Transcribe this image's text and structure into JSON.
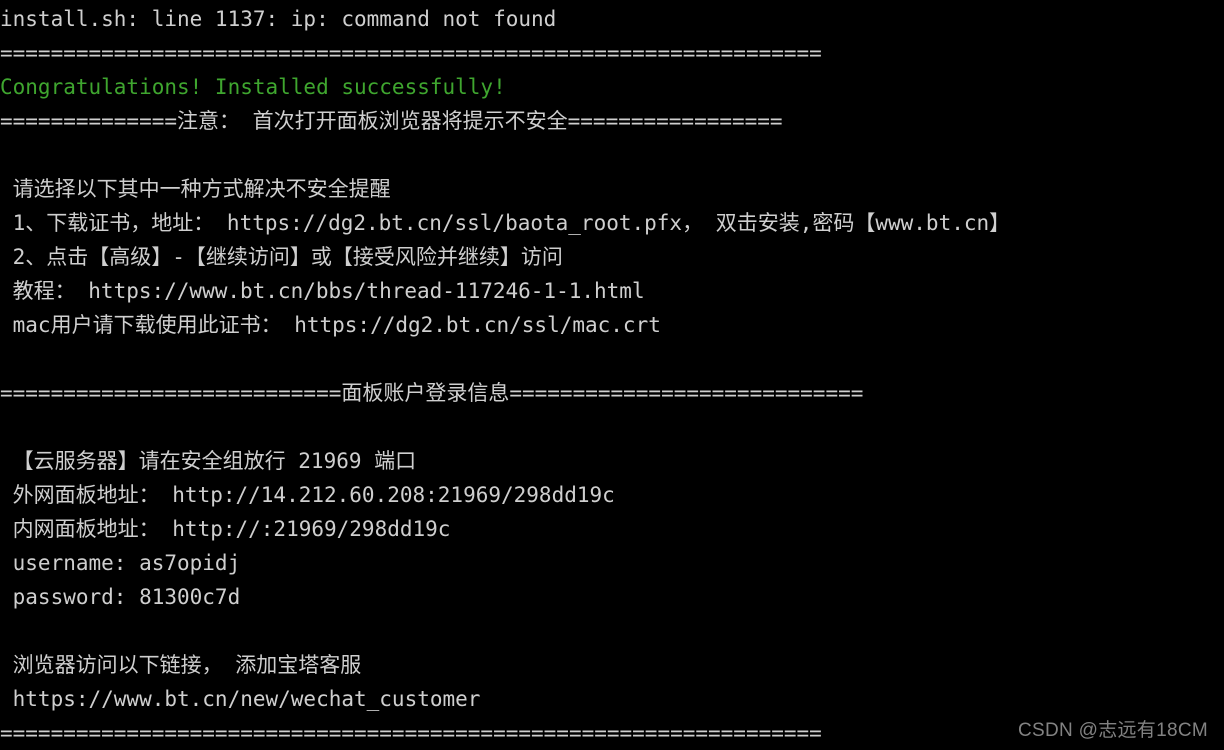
{
  "terminal": {
    "background_color": "#000000",
    "foreground_color": "#cfcfcf",
    "success_color": "#3fa62f",
    "lines": [
      {
        "id": "l01",
        "text": "install.sh: line 1137: ip: command not found",
        "style": "normal"
      },
      {
        "id": "l02",
        "text": "=================================================================",
        "style": "sep"
      },
      {
        "id": "l03",
        "text": "Congratulations! Installed successfully!",
        "style": "green"
      },
      {
        "id": "l04",
        "text": "==============注意： 首次打开面板浏览器将提示不安全=================",
        "style": "normal"
      },
      {
        "id": "l05",
        "text": "",
        "style": "blank"
      },
      {
        "id": "l06",
        "text": " 请选择以下其中一种方式解决不安全提醒",
        "style": "normal"
      },
      {
        "id": "l07",
        "text": " 1、下载证书，地址： https://dg2.bt.cn/ssl/baota_root.pfx， 双击安装,密码【www.bt.cn】",
        "style": "normal"
      },
      {
        "id": "l08",
        "text": " 2、点击【高级】-【继续访问】或【接受风险并继续】访问",
        "style": "normal"
      },
      {
        "id": "l09",
        "text": " 教程： https://www.bt.cn/bbs/thread-117246-1-1.html",
        "style": "normal"
      },
      {
        "id": "l10",
        "text": " mac用户请下载使用此证书： https://dg2.bt.cn/ssl/mac.crt",
        "style": "normal"
      },
      {
        "id": "l11",
        "text": "",
        "style": "blank"
      },
      {
        "id": "l12",
        "text": "===========================面板账户登录信息============================",
        "style": "normal"
      },
      {
        "id": "l13",
        "text": "",
        "style": "blank"
      },
      {
        "id": "l14",
        "text": " 【云服务器】请在安全组放行 21969 端口",
        "style": "normal"
      },
      {
        "id": "l15",
        "text": " 外网面板地址： http://14.212.60.208:21969/298dd19c",
        "style": "normal"
      },
      {
        "id": "l16",
        "text": " 内网面板地址： http://:21969/298dd19c",
        "style": "normal"
      },
      {
        "id": "l17",
        "text": " username: as7opidj",
        "style": "normal"
      },
      {
        "id": "l18",
        "text": " password: 81300c7d",
        "style": "normal"
      },
      {
        "id": "l19",
        "text": "",
        "style": "blank"
      },
      {
        "id": "l20",
        "text": " 浏览器访问以下链接， 添加宝塔客服",
        "style": "normal"
      },
      {
        "id": "l21",
        "text": " https://www.bt.cn/new/wechat_customer",
        "style": "normal"
      },
      {
        "id": "l22",
        "text": "=================================================================",
        "style": "sep"
      }
    ],
    "details": {
      "script_name": "install.sh",
      "error_line_number": "1137",
      "error_command": "ip",
      "error_message": "command not found",
      "success_message": "Congratulations! Installed successfully!",
      "cert_download_url": "https://dg2.bt.cn/ssl/baota_root.pfx",
      "cert_password": "www.bt.cn",
      "tutorial_url": "https://www.bt.cn/bbs/thread-117246-1-1.html",
      "mac_cert_url": "https://dg2.bt.cn/ssl/mac.crt",
      "panel_port": "21969",
      "external_panel_url": "http://14.212.60.208:21969/298dd19c",
      "internal_panel_url": "http://:21969/298dd19c",
      "username": "as7opidj",
      "password": "81300c7d",
      "wechat_customer_url": "https://www.bt.cn/new/wechat_customer"
    }
  },
  "watermark": {
    "text": "CSDN @志远有18CM"
  }
}
